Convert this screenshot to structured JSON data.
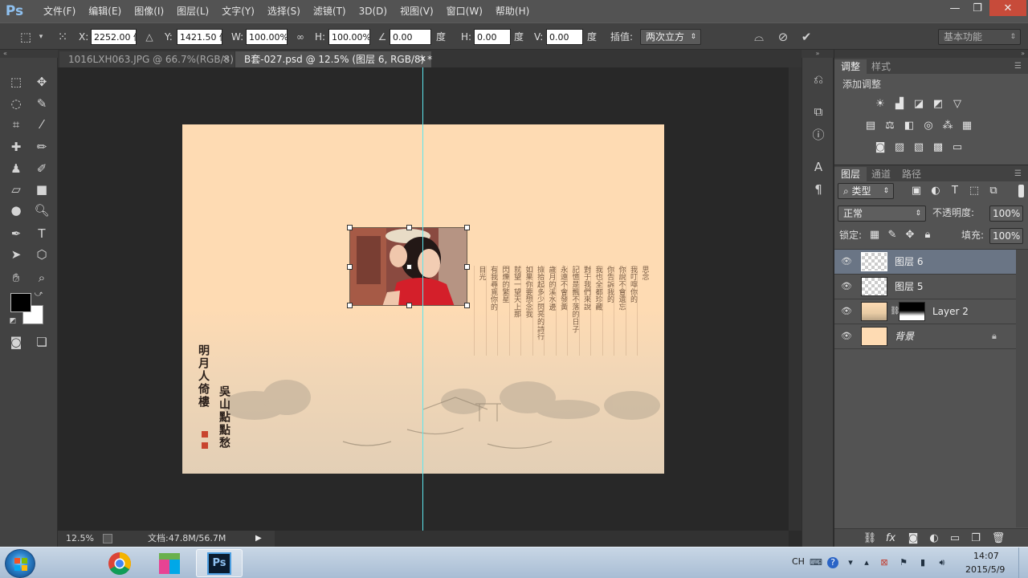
{
  "app": {
    "logo": "Ps",
    "menu": [
      "文件(F)",
      "编辑(E)",
      "图像(I)",
      "图层(L)",
      "文字(Y)",
      "选择(S)",
      "滤镜(T)",
      "3D(D)",
      "视图(V)",
      "窗口(W)",
      "帮助(H)"
    ]
  },
  "window_controls": {
    "minimize": "—",
    "restore": "❐",
    "close": "✕"
  },
  "options": {
    "x_label": "X:",
    "x_value": "2252.00 像",
    "y_label": "Y:",
    "y_value": "1421.50 像",
    "w_label": "W:",
    "w_value": "100.00%",
    "h_label": "H:",
    "h_value": "100.00%",
    "angle_value": "0.00",
    "deg1": "度",
    "hskew_label": "H:",
    "hskew_value": "0.00",
    "deg2": "度",
    "vskew_label": "V:",
    "vskew_value": "0.00",
    "deg3": "度",
    "interp_label": "插值:",
    "interp_value": "两次立方",
    "workspace": "基本功能"
  },
  "tabs": [
    {
      "label": "1016LXH063.JPG @ 66.7%(RGB/8)",
      "close": "✕"
    },
    {
      "label": "B套-027.psd @ 12.5% (图层 6, RGB/8) *",
      "close": "✕"
    }
  ],
  "document": {
    "poem_columns": [
      "思念",
      "我叮嚀你的",
      "你說不會遺忘",
      "你告訴我的",
      "我也全都珍藏",
      "對于我們來說",
      "記憶是飄不落的日子",
      "永遠不會發黃",
      "歲月的溪水邊",
      "撿拾起多少閃亮的詩行",
      "如果你要想念我",
      "就望一望天上那",
      "閃爍的繁星",
      "有我尋覓你的",
      "目光"
    ],
    "calligraphy_left": "明月人倚樓",
    "calligraphy_right": "吳山點點愁"
  },
  "status": {
    "zoom": "12.5%",
    "doc": "文档:47.8M/56.7M"
  },
  "adjustments": {
    "tabs": [
      "调整",
      "样式"
    ],
    "heading": "添加调整"
  },
  "layers": {
    "tabs": [
      "图层",
      "通道",
      "路径"
    ],
    "filter_label": "类型",
    "blend_mode": "正常",
    "opacity_label": "不透明度:",
    "opacity_value": "100%",
    "lock_label": "锁定:",
    "fill_label": "填充:",
    "fill_value": "100%",
    "items": [
      {
        "name": "图层 6",
        "selected": true
      },
      {
        "name": "图层 5",
        "selected": false
      },
      {
        "name": "Layer 2",
        "selected": false
      },
      {
        "name": "背景",
        "selected": false
      }
    ]
  },
  "taskbar": {
    "lang": "CH",
    "time": "14:07",
    "date": "2015/5/9",
    "ps_label": "Ps"
  },
  "colors": {
    "canvas_paper": "#fedbb3",
    "guide": "#5de6ee",
    "selection": "#6a7585"
  }
}
